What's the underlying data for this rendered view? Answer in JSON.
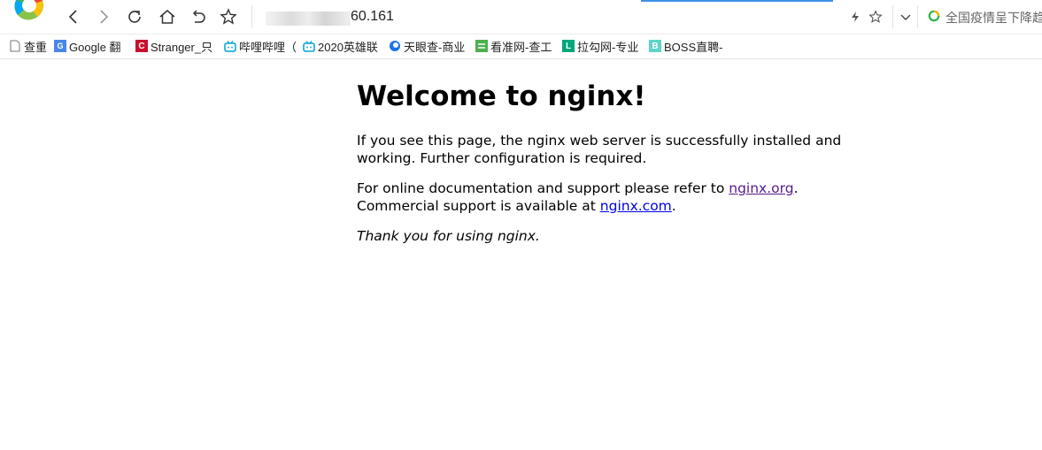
{
  "browser": {
    "address_suffix": "60.161",
    "search_hint": "全国疫情呈下降趋"
  },
  "bookmarks": [
    {
      "label": "查重",
      "icon": "page-icon"
    },
    {
      "label": "Google 翻",
      "icon": "google-translate-icon"
    },
    {
      "label": "Stranger_只",
      "icon": "csdn-icon"
    },
    {
      "label": "哔哩哔哩（",
      "icon": "bilibili-icon"
    },
    {
      "label": "2020英雄联",
      "icon": "bilibili-icon"
    },
    {
      "label": "天眼查-商业",
      "icon": "tianyancha-icon"
    },
    {
      "label": "看准网-查工",
      "icon": "kanzhun-icon"
    },
    {
      "label": "拉勾网-专业",
      "icon": "lagou-icon"
    },
    {
      "label": "BOSS直聘-",
      "icon": "boss-icon"
    }
  ],
  "page": {
    "title": "Welcome to nginx!",
    "p1": "If you see this page, the nginx web server is successfully installed and working. Further configuration is required.",
    "p2_before": "For online documentation and support please refer to ",
    "link1": "nginx.org",
    "p2_mid": ".",
    "p2_line2": "Commercial support is available at ",
    "link2": "nginx.com",
    "p2_end": ".",
    "thanks": "Thank you for using nginx."
  },
  "colors": {
    "visited_link": "#551a8b",
    "link": "#0000ee",
    "progress": "#3d8fe8"
  }
}
